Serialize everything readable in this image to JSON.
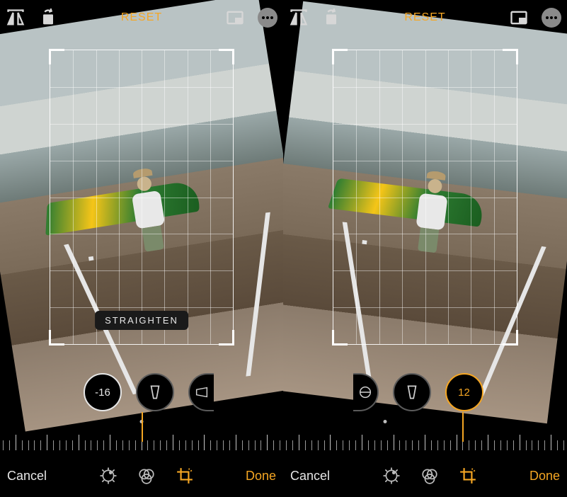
{
  "screens": [
    {
      "topbar": {
        "reset": "RESET"
      },
      "crop": {
        "label": "STRAIGHTEN"
      },
      "dials": {
        "straighten_value": "-16"
      },
      "bottom": {
        "cancel": "Cancel",
        "done": "Done"
      }
    },
    {
      "topbar": {
        "reset": "RESET"
      },
      "dials": {
        "horizontal_value": "12"
      },
      "bottom": {
        "cancel": "Cancel",
        "done": "Done"
      }
    }
  ],
  "colors": {
    "accent": "#f5a623"
  }
}
